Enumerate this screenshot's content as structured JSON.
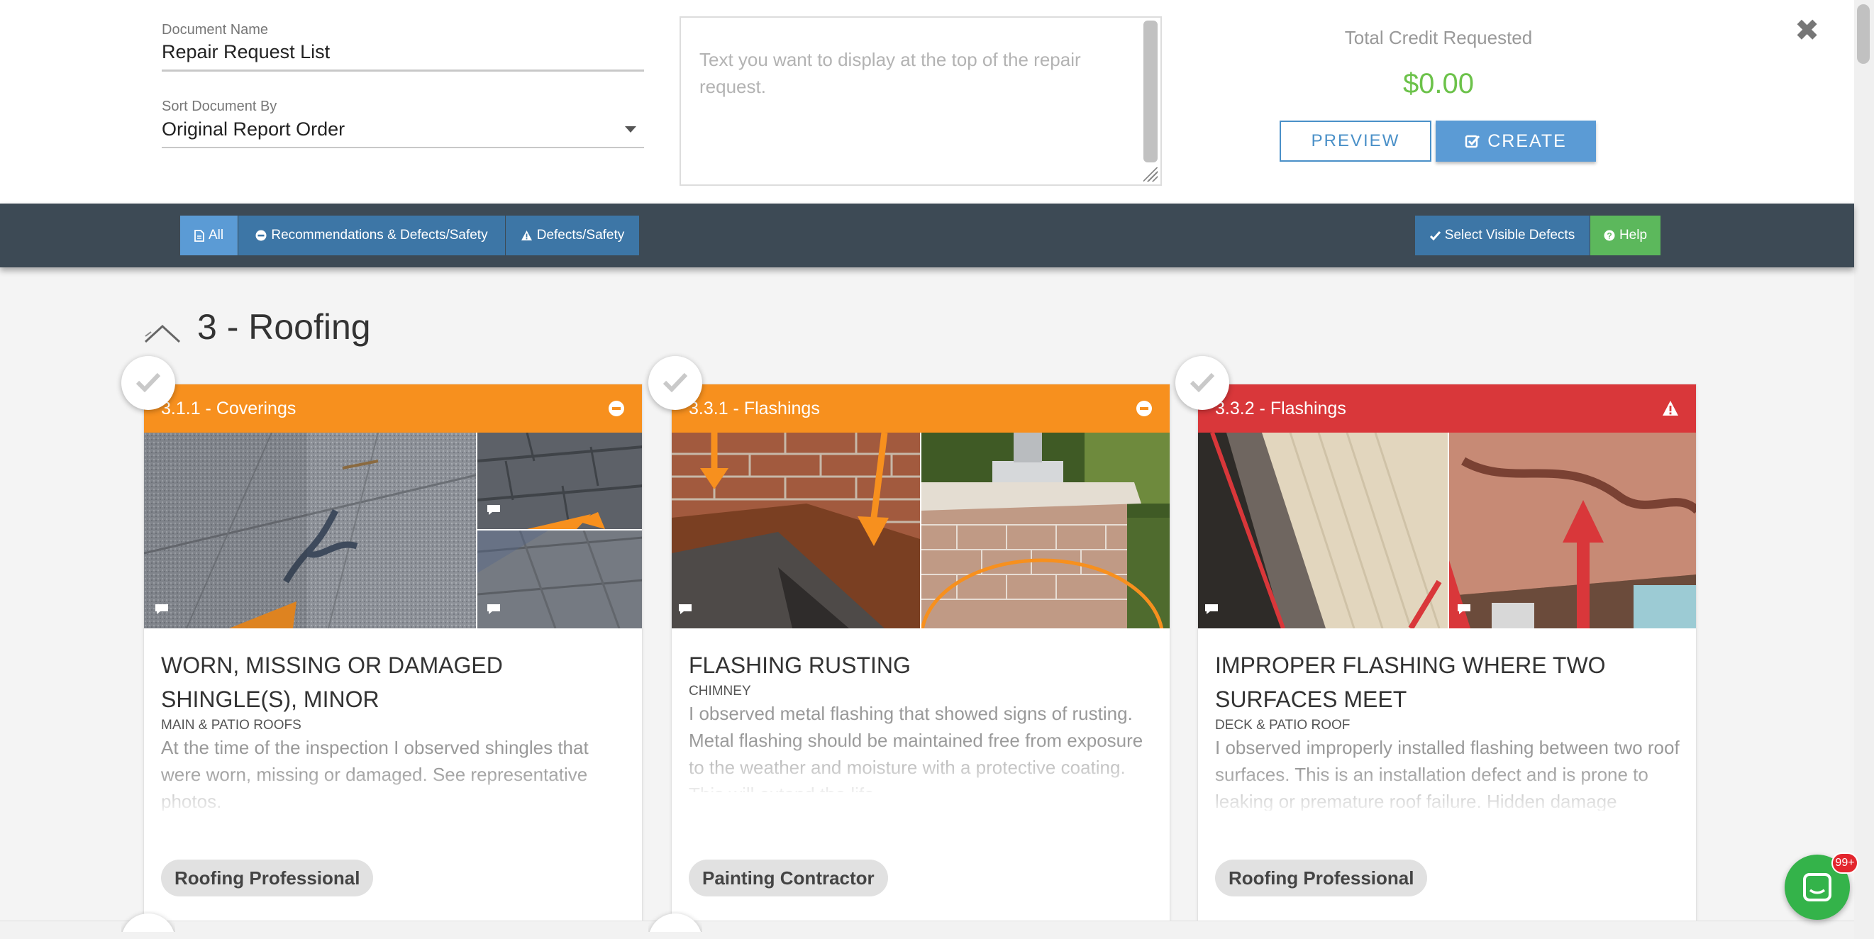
{
  "form": {
    "document_name_label": "Document Name",
    "document_name_value": "Repair Request List",
    "sort_label": "Sort Document By",
    "sort_value": "Original Report Order",
    "intro_placeholder": "Text you want to display at the top of the repair request."
  },
  "credit": {
    "label": "Total Credit Requested",
    "value": "$0.00"
  },
  "actions": {
    "preview": "PREVIEW",
    "create": "CREATE"
  },
  "filters": {
    "all": "All",
    "recommendations": "Recommendations & Defects/Safety",
    "defects": "Defects/Safety",
    "select_visible": "Select Visible Defects",
    "help": "Help"
  },
  "section": {
    "title": "3 - Roofing"
  },
  "cards": [
    {
      "header": "3.1.1 - Coverings",
      "header_color": "#f7901e",
      "header_icon": "minus-circle-icon",
      "title": "Worn, Missing or Damaged Shingle(s), Minor",
      "location": "Main & Patio Roofs",
      "description": "At the time of the inspection I observed shingles that were worn, missing or damaged. See representative photos.",
      "tag": "Roofing Professional"
    },
    {
      "header": "3.3.1 - Flashings",
      "header_color": "#f7901e",
      "header_icon": "minus-circle-icon",
      "title": "Flashing Rusting",
      "location": "Chimney",
      "description": "I observed metal flashing that showed signs of rusting. Metal flashing should be maintained free from exposure to the weather and moisture with a protective coating. This will extend the life",
      "tag": "Painting Contractor"
    },
    {
      "header": "3.3.2 - Flashings",
      "header_color": "#d9373a",
      "header_icon": "warning-triangle-icon",
      "title": "Improper Flashing Where Two Surfaces Meet",
      "location": "Deck & Patio Roof",
      "description": "I observed improperly installed flashing between two roof surfaces. This is an installation defect and is prone to leaking or premature roof failure. Hidden damage",
      "tag": "Roofing Professional"
    }
  ],
  "chat": {
    "badge": "99+"
  },
  "colors": {
    "accent": "#5b9bd5",
    "filter_bar": "#3d4a55",
    "credit": "#6cc24a",
    "recommendation": "#f7901e",
    "safety": "#d9373a",
    "help": "#5cb85c"
  }
}
